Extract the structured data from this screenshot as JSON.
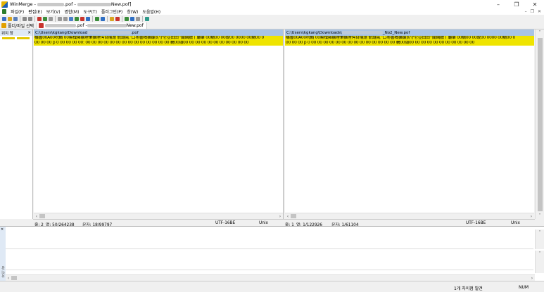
{
  "window": {
    "title_app": "WinMerge - ",
    "title_mid": ".pof - ",
    "title_end": "New.pof]",
    "btn_minimize": "–",
    "btn_restore": "❐",
    "btn_close": "✕"
  },
  "menu": {
    "items": [
      "파일(F)",
      "편집(E)",
      "보기(V)",
      "병합(M)",
      "도구(T)",
      "플러그인(P)",
      "창(W)",
      "도움말(H)"
    ],
    "mdi_minimize": "–",
    "mdi_restore": "❐",
    "mdi_close": "✕"
  },
  "tabs": {
    "open_label": "폴더/파일 선택",
    "file_tab_mid": ".pof - ",
    "file_tab_end": "New.pof"
  },
  "location_pane": {
    "label": "위치 창",
    "close": "✕"
  },
  "left_pane": {
    "path_start": "C:\\Users\\kgkang\\Download",
    "path_end": ".pof",
    "line1": "犠曇00A00唍鯛 00鮤檁擁擃堙秉擴堙偔甘揣澹 骯譢氝 ·口枣曇楬擴嫝炙守仑亞田田··闐網臘丨麏肇 00鯛00 00旼00 0000 00鯛00 0",
    "line2": "00 00 00 p 0 00 00 00 00: 00 00 00 00 00 00 00 00 00 00 00 00 00 00   鶤00頌00 00   00 00 00 00 00 00 00 00 00",
    "stat_line_label": "줄: 2",
    "stat_col_label": "열: 50/264238",
    "stat_char_label": "문자: 18/99797",
    "stat_encoding": "UTF-16BE",
    "stat_eol": "Unix"
  },
  "right_pane": {
    "path_start": "C:\\Users\\kgkang\\Downloads\\",
    "path_end": "_No2_New.pof",
    "line1": "犠曇00A00唍鯛 00鮤檁擁擃堙秉擴堙偔甘揣澹 骯譢氝 ·口枣曇楬擴嫝炙守仑亞田田··闐網臘丨麏肇 00鯛00 00旼00 0000 00鯛00 0",
    "line2": "00 00 00 p 0 00 00 00 00 00 00 00 00 00 00 00 00 00 00   鶤00頌00 00   00 00 00 00 00 00 00 00 00",
    "stat_line_label": "줄: 1",
    "stat_col_label": "열: 1/122926",
    "stat_char_label": "문자: 1/61104",
    "stat_encoding": "UTF-16BE",
    "stat_eol": "Unix"
  },
  "diff_pane": {
    "label": "차이 창",
    "close": "✕"
  },
  "statusbar": {
    "diff_count": "1개 차이점 발견",
    "num": "NUM"
  },
  "scroll": {
    "left": "‹",
    "right": "›",
    "up": "˄",
    "down": "˅"
  },
  "colors": {
    "diff_highlight": "#efe400",
    "path_header": "#a8c4e6"
  }
}
